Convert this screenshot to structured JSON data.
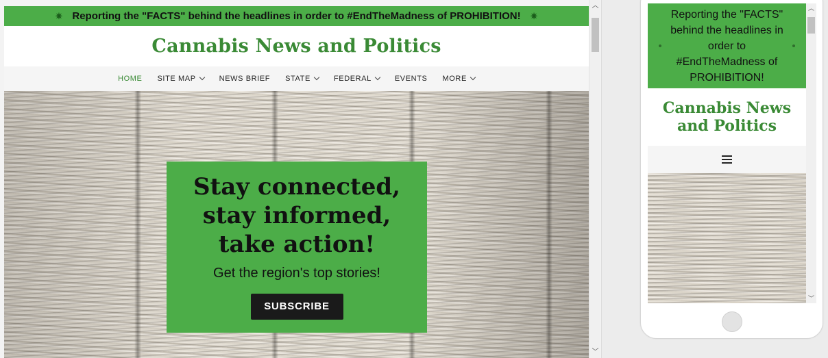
{
  "banner": {
    "text": "Reporting the \"FACTS\" behind the headlines in order to #EndTheMadness of PROHIBITION!",
    "left_icon": "cannabis-leaf-icon",
    "right_icon": "cannabis-leaf-icon"
  },
  "site": {
    "title": "Cannabis News and Politics"
  },
  "nav": {
    "items": [
      {
        "label": "HOME",
        "active": true,
        "dropdown": false
      },
      {
        "label": "SITE MAP",
        "active": false,
        "dropdown": true
      },
      {
        "label": "NEWS BRIEF",
        "active": false,
        "dropdown": false
      },
      {
        "label": "STATE",
        "active": false,
        "dropdown": true
      },
      {
        "label": "FEDERAL",
        "active": false,
        "dropdown": true
      },
      {
        "label": "EVENTS",
        "active": false,
        "dropdown": false
      },
      {
        "label": "MORE",
        "active": false,
        "dropdown": true
      }
    ]
  },
  "promo": {
    "headline_line1": "Stay connected,",
    "headline_line2": "stay informed,",
    "headline_line3": "take action!",
    "subtitle": "Get the region's top stories!",
    "button_label": "SUBSCRIBE"
  },
  "mobile": {
    "banner_text": "Reporting the \"FACTS\" behind the headlines in order to #EndTheMadness of PROHIBITION!",
    "title": "Cannabis News and Politics",
    "menu_icon": "hamburger-menu-icon"
  },
  "scrollbar": {
    "up_icon": "chevron-up-icon",
    "down_icon": "chevron-down-icon"
  },
  "colors": {
    "brand_green": "#4cad48",
    "title_green": "#3a8a35",
    "button_dark": "#1a1a1a"
  }
}
